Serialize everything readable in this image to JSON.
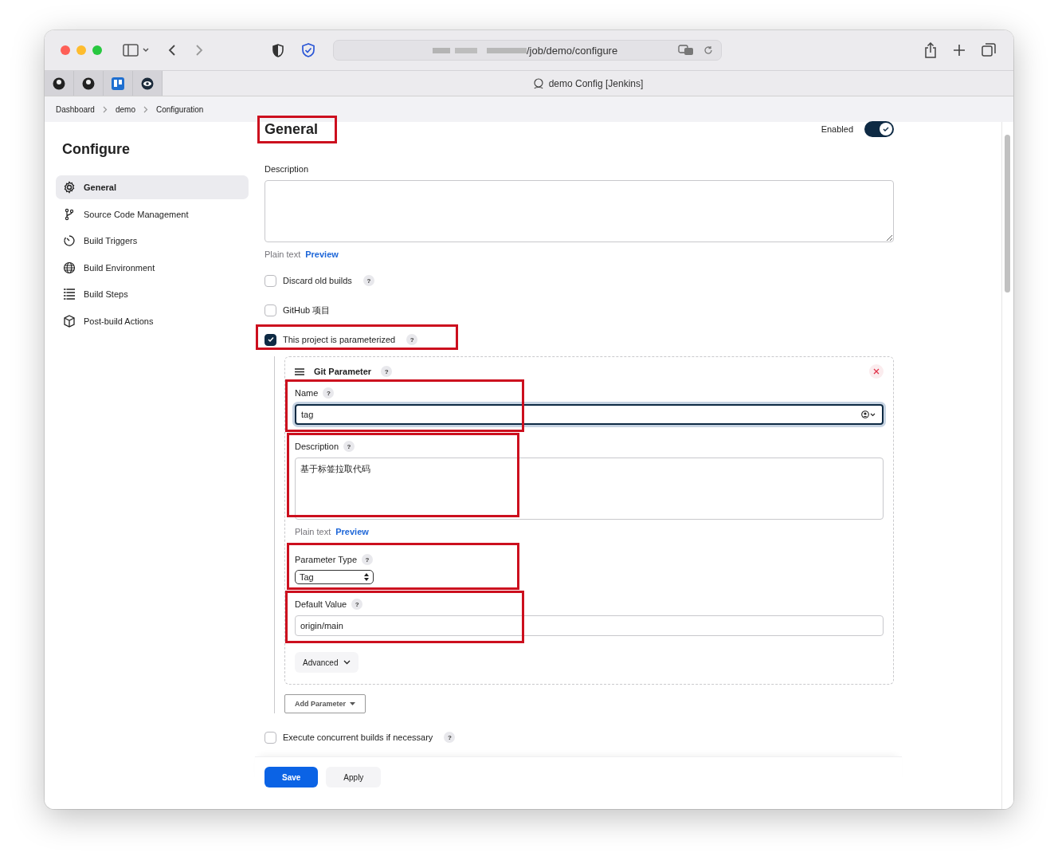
{
  "browser": {
    "url": "/job/demo/configure",
    "tab_title": "demo Config [Jenkins]"
  },
  "breadcrumbs": [
    "Dashboard",
    "demo",
    "Configuration"
  ],
  "sidebar": {
    "title": "Configure",
    "items": [
      {
        "label": "General",
        "selected": true,
        "kind": "gear"
      },
      {
        "label": "Source Code Management",
        "selected": false,
        "kind": "branch"
      },
      {
        "label": "Build Triggers",
        "selected": false,
        "kind": "clock"
      },
      {
        "label": "Build Environment",
        "selected": false,
        "kind": "globe"
      },
      {
        "label": "Build Steps",
        "selected": false,
        "kind": "list"
      },
      {
        "label": "Post-build Actions",
        "selected": false,
        "kind": "box"
      }
    ]
  },
  "section": {
    "title": "General",
    "highlighted": true,
    "toggle": {
      "label": "Enabled",
      "on": true
    }
  },
  "description": {
    "label": "Description",
    "plain_text": "Plain text",
    "preview": "Preview"
  },
  "options": [
    {
      "label": "Discard old builds",
      "checked": false,
      "help": "?",
      "highlighted": false
    },
    {
      "label": "GitHub 项目",
      "checked": false,
      "highlighted": false
    },
    {
      "label": "This project is parameterized",
      "checked": true,
      "help": "?",
      "highlighted": true
    }
  ],
  "parameter": {
    "title": "Git Parameter",
    "help": "?",
    "fields": [
      {
        "kind": "text",
        "label": "Name",
        "help": "?",
        "value": "tag",
        "focused": true,
        "highlighted": true
      },
      {
        "kind": "textarea",
        "label": "Description",
        "help": "?",
        "value": "基于标签拉取代码",
        "plain_text": "Plain text",
        "preview": "Preview",
        "focused": false,
        "highlighted": true
      },
      {
        "kind": "select",
        "label": "Parameter Type",
        "help": "?",
        "value": "Tag",
        "focused": false,
        "highlighted": true
      },
      {
        "kind": "text",
        "label": "Default Value",
        "help": "?",
        "value": "origin/main",
        "focused": false,
        "highlighted": true
      }
    ],
    "advanced": "Advanced"
  },
  "add_parameter": "Add Parameter",
  "concurrent": {
    "label": "Execute concurrent builds if necessary",
    "checked": false,
    "help": "?"
  },
  "buttons": [
    {
      "label": "Save",
      "kind": "primary"
    },
    {
      "label": "Apply",
      "kind": "secondary"
    }
  ]
}
